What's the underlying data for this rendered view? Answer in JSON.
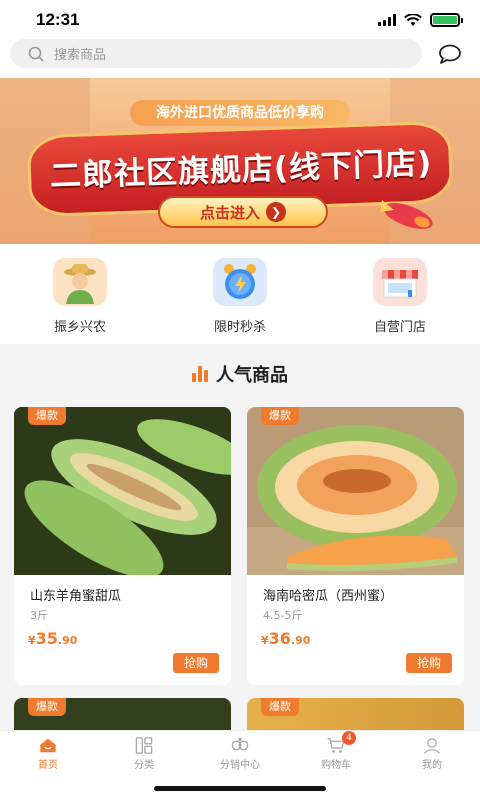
{
  "status_bar": {
    "time": "12:31"
  },
  "search": {
    "placeholder": "搜索商品"
  },
  "banner": {
    "subtitle": "海外进口优质商品低价享购",
    "headline": "二郎社区旗舰店(线下门店)",
    "cta": "点击进入"
  },
  "categories": [
    {
      "label": "振乡兴农",
      "icon": "farmer-icon"
    },
    {
      "label": "限时秒杀",
      "icon": "alarm-clock-icon"
    },
    {
      "label": "自营门店",
      "icon": "storefront-icon"
    }
  ],
  "section": {
    "title": "人气商品"
  },
  "products": [
    {
      "badge": "爆款",
      "name": "山东羊角蜜甜瓜",
      "spec": "3斤",
      "currency": "¥",
      "price_int": "35",
      "price_dec": ".90",
      "buy": "抢购"
    },
    {
      "badge": "爆款",
      "name": "海南哈密瓜（西州蜜）",
      "spec": "4.5-5斤",
      "currency": "¥",
      "price_int": "36",
      "price_dec": ".90",
      "buy": "抢购"
    },
    {
      "badge": "爆款"
    },
    {
      "badge": "爆款"
    }
  ],
  "tabs": [
    {
      "label": "首页",
      "icon": "home-icon",
      "active": true
    },
    {
      "label": "分类",
      "icon": "category-icon"
    },
    {
      "label": "分销中心",
      "icon": "distribution-icon"
    },
    {
      "label": "购物车",
      "icon": "cart-icon",
      "badge": "4"
    },
    {
      "label": "我的",
      "icon": "profile-icon"
    }
  ],
  "colors": {
    "accent": "#f07a2e",
    "banner_red": "#c41f22"
  }
}
